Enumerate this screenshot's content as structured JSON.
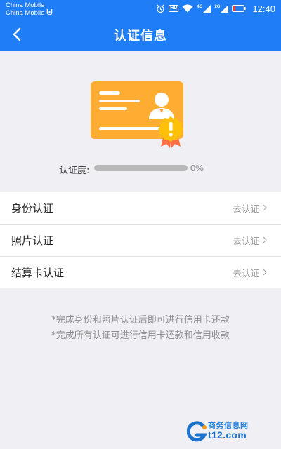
{
  "status_bar": {
    "carrier_1": "China Mobile",
    "carrier_2": "China Mobile",
    "hd_badge": "HD",
    "net_1": "4G",
    "net_2": "2G",
    "time": "12:40"
  },
  "nav": {
    "title": "认证信息"
  },
  "progress": {
    "label": "认证度:",
    "value_text": "0%",
    "fraction": 0
  },
  "list": {
    "items": [
      {
        "label": "身份认证",
        "action": "去认证"
      },
      {
        "label": "照片认证",
        "action": "去认证"
      },
      {
        "label": "结算卡认证",
        "action": "去认证"
      }
    ]
  },
  "notes": {
    "line_1": "*完成身份和照片认证后即可进行信用卡还款",
    "line_2": "*完成所有认证可进行信用卡还款和信用收款"
  },
  "watermark": {
    "text_cn": "商务信息网",
    "text_url": "t12.com"
  },
  "colors": {
    "brand_blue": "#1f7ef5",
    "card_orange": "#ffa726",
    "badge_yellow": "#ffc107"
  }
}
